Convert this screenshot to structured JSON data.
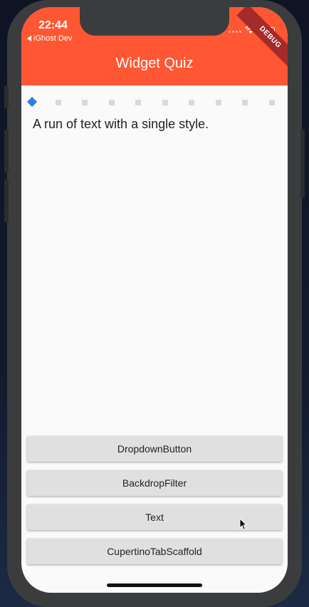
{
  "status_bar": {
    "time": "22:44",
    "back_app": "iGhost Dev",
    "wifi_icon": "wifi-icon",
    "battery_icon": "battery-icon"
  },
  "debug_banner": "DEBUG",
  "app_bar": {
    "title": "Widget Quiz",
    "color": "#ff5733"
  },
  "progress": {
    "total": 10,
    "current": 1,
    "active_color": "#2f80d8"
  },
  "question": {
    "text": "A run of text with a single style."
  },
  "answers": [
    {
      "label": "DropdownButton"
    },
    {
      "label": "BackdropFilter"
    },
    {
      "label": "Text"
    },
    {
      "label": "CupertinoTabScaffold"
    }
  ]
}
